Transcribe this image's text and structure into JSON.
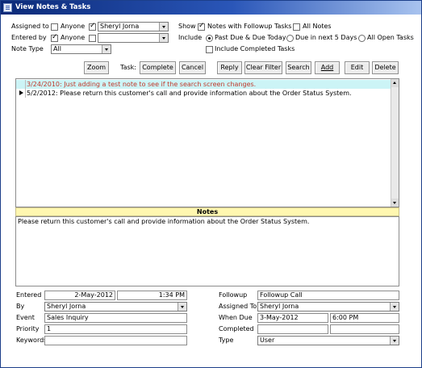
{
  "window": {
    "title": "View Notes & Tasks"
  },
  "filters": {
    "assigned_to_label": "Assigned to",
    "assigned_anyone_label": "Anyone",
    "assigned_anyone_checked": false,
    "assigned_user_checked": true,
    "assigned_user_value": "Sheryl Jorna",
    "entered_by_label": "Entered by",
    "entered_anyone_label": "Anyone",
    "entered_anyone_checked": true,
    "entered_user_checked": false,
    "entered_user_value": "",
    "note_type_label": "Note Type",
    "note_type_value": "All",
    "show_label": "Show",
    "followup_tasks_label": "Notes with Followup Tasks",
    "followup_tasks_checked": true,
    "all_notes_label": "All Notes",
    "all_notes_checked": false,
    "include_label": "Include",
    "past_due_label": "Past Due & Due Today",
    "due_next_label": "Due in next 5 Days",
    "all_open_label": "All Open Tasks",
    "include_selected": "past_due",
    "include_completed_label": "Include Completed Tasks",
    "include_completed_checked": false
  },
  "toolbar": {
    "zoom": "Zoom",
    "task_label": "Task:",
    "complete": "Complete",
    "cancel": "Cancel",
    "reply": "Reply",
    "clear_filter": "Clear Filter",
    "search": "Search",
    "add": "Add",
    "edit": "Edit",
    "delete": "Delete"
  },
  "notes_list": [
    {
      "text": "3/24/2010: Just adding a test note to see if the search screen changes.",
      "highlighted": true,
      "current": false
    },
    {
      "text": "5/2/2012: Please return this customer's call and provide information about the Order Status  System.",
      "highlighted": false,
      "current": true
    }
  ],
  "notes_panel": {
    "header": "Notes",
    "body": "Please return this customer's call and provide information about the Order Status  System."
  },
  "detail": {
    "entered_label": "Entered",
    "entered_date": "2-May-2012",
    "entered_time": "1:34 PM",
    "by_label": "By",
    "by_value": "Sheryl Jorna",
    "event_label": "Event",
    "event_value": "Sales Inquiry",
    "priority_label": "Priority",
    "priority_value": "1",
    "keywords_label": "Keywords",
    "keywords_value": "",
    "followup_label": "Followup",
    "followup_value": "Followup Call",
    "assigned_to_label": "Assigned To",
    "assigned_to_value": "Sheryl Jorna",
    "when_due_label": "When Due",
    "when_due_date": "3-May-2012",
    "when_due_time": "6:00 PM",
    "completed_label": "Completed",
    "completed_date": "",
    "completed_time": "",
    "type_label": "Type",
    "type_value": "User"
  },
  "colors": {
    "title_bar": "#0b2a78",
    "selected_row_bg": "#ccf4f6",
    "selected_row_text": "#c0392b",
    "notes_header_bg": "#fff7b0"
  }
}
